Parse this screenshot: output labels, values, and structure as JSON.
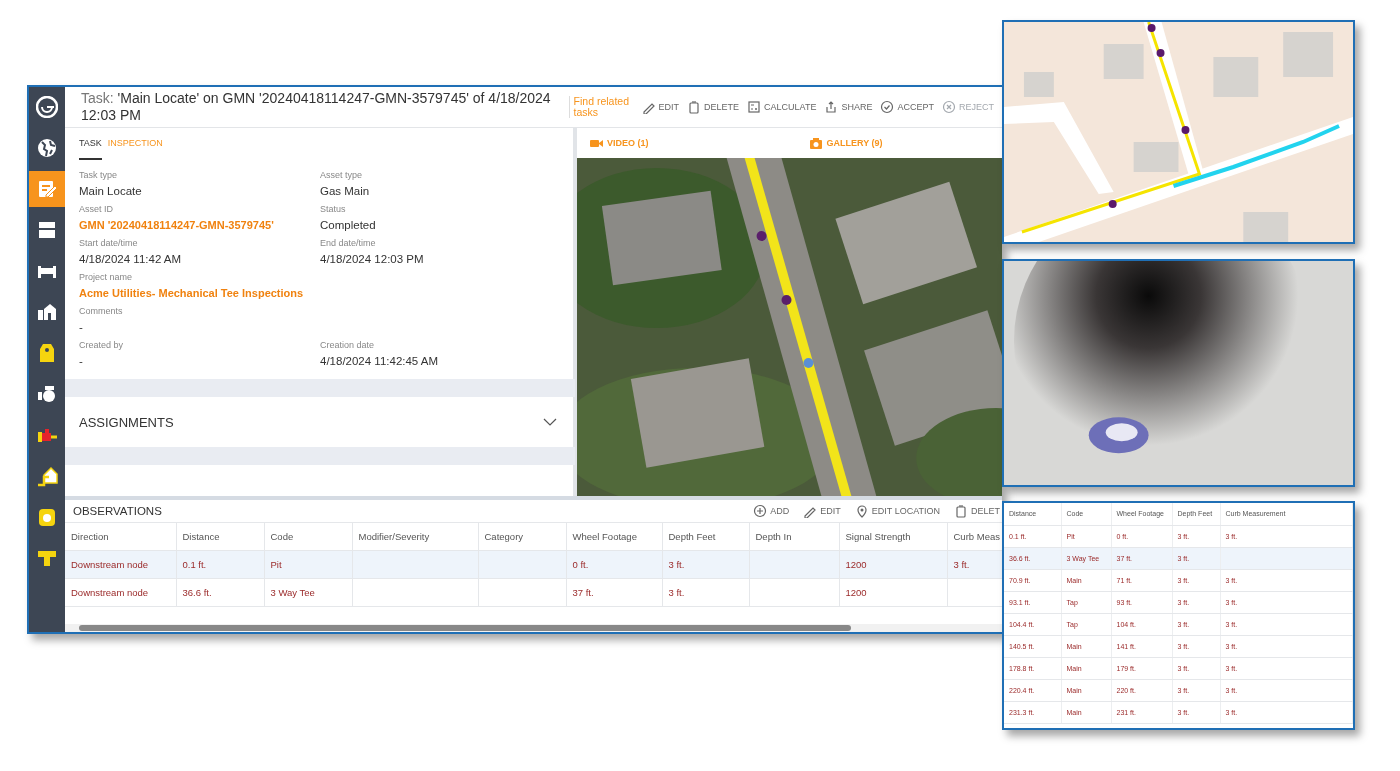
{
  "sidebar": {
    "items": [
      {
        "selected": false
      },
      {
        "selected": false
      },
      {
        "selected": true
      },
      {
        "selected": false
      },
      {
        "selected": false
      },
      {
        "selected": false
      },
      {
        "selected": false
      },
      {
        "selected": false
      },
      {
        "selected": false
      },
      {
        "selected": false
      },
      {
        "selected": false
      },
      {
        "selected": false
      }
    ]
  },
  "header": {
    "title_prefix": "Task:",
    "title": "'Main Locate' on GMN '20240418114247-GMN-3579745' of 4/18/2024 12:03 PM",
    "related_link": "Find related tasks",
    "actions": [
      {
        "label": "EDIT",
        "disabled": false
      },
      {
        "label": "DELETE",
        "disabled": false
      },
      {
        "label": "CALCULATE",
        "disabled": false
      },
      {
        "label": "SHARE",
        "disabled": false
      },
      {
        "label": "ACCEPT",
        "disabled": false
      },
      {
        "label": "REJECT",
        "disabled": true
      }
    ]
  },
  "tabs": [
    {
      "label": "TASK",
      "selected": true
    },
    {
      "label": "INSPECTION",
      "selected": false
    }
  ],
  "field_rows": [
    [
      {
        "label": "Task type",
        "value": "Main Locate",
        "kind": "text"
      },
      {
        "label": "Asset type",
        "value": "Gas Main",
        "kind": "text"
      }
    ],
    [
      {
        "label": "Asset ID",
        "value": "GMN '20240418114247-GMN-3579745'",
        "kind": "link"
      },
      {
        "label": "Status",
        "value": "Completed",
        "kind": "text"
      }
    ],
    [
      {
        "label": "Start date/time",
        "value": "4/18/2024 11:42 AM",
        "kind": "text"
      },
      {
        "label": "End date/time",
        "value": "4/18/2024 12:03 PM",
        "kind": "text"
      }
    ],
    [
      {
        "label": "Project name",
        "value": "Acme Utilities- Mechanical Tee Inspections",
        "kind": "link"
      }
    ],
    [
      {
        "label": "Comments",
        "value": "-",
        "kind": "text"
      }
    ],
    [
      {
        "label": "Created by",
        "value": "-",
        "kind": "text"
      },
      {
        "label": "Creation date",
        "value": "4/18/2024 11:42:45 AM",
        "kind": "text"
      }
    ]
  ],
  "assignments": {
    "title": "ASSIGNMENTS",
    "expanded": false
  },
  "media_tabs": [
    {
      "label": "VIDEO (1)"
    },
    {
      "label": "GALLERY (9)"
    }
  ],
  "observations": {
    "title": "OBSERVATIONS",
    "actions": [
      {
        "label": "ADD"
      },
      {
        "label": "EDIT"
      },
      {
        "label": "EDIT LOCATION"
      },
      {
        "label": "DELET"
      }
    ],
    "columns": [
      "Direction",
      "Distance",
      "Code",
      "Modifier/Severity",
      "Category",
      "Wheel Footage",
      "Depth Feet",
      "Depth In",
      "Signal Strength",
      "Curb Meas"
    ],
    "rows": [
      {
        "selected": true,
        "cells": [
          "Downstream node",
          "0.1 ft.",
          "Pit",
          "",
          "",
          "0 ft.",
          "3 ft.",
          "",
          "1200",
          "3 ft."
        ]
      },
      {
        "selected": false,
        "cells": [
          "Downstream node",
          "36.6 ft.",
          "3 Way Tee",
          "",
          "",
          "37 ft.",
          "3 ft.",
          "",
          "1200",
          ""
        ]
      }
    ]
  },
  "side_table": {
    "columns": [
      "Distance",
      "Code",
      "Wheel Footage",
      "Depth Feet",
      "Curb Measurement"
    ],
    "rows": [
      {
        "selected": false,
        "cells": [
          "0.1 ft.",
          "Pit",
          "0 ft.",
          "3 ft.",
          "3 ft."
        ]
      },
      {
        "selected": true,
        "cells": [
          "36.6 ft.",
          "3 Way Tee",
          "37 ft.",
          "3 ft.",
          ""
        ]
      },
      {
        "selected": false,
        "cells": [
          "70.9 ft.",
          "Main",
          "71 ft.",
          "3 ft.",
          "3 ft."
        ]
      },
      {
        "selected": false,
        "cells": [
          "93.1 ft.",
          "Tap",
          "93 ft.",
          "3 ft.",
          "3 ft."
        ]
      },
      {
        "selected": false,
        "cells": [
          "104.4 ft.",
          "Tap",
          "104 ft.",
          "3 ft.",
          "3 ft."
        ]
      },
      {
        "selected": false,
        "cells": [
          "140.5 ft.",
          "Main",
          "141 ft.",
          "3 ft.",
          "3 ft."
        ]
      },
      {
        "selected": false,
        "cells": [
          "178.8 ft.",
          "Main",
          "179 ft.",
          "3 ft.",
          "3 ft."
        ]
      },
      {
        "selected": false,
        "cells": [
          "220.4 ft.",
          "Main",
          "220 ft.",
          "3 ft.",
          "3 ft."
        ]
      },
      {
        "selected": false,
        "cells": [
          "231.3 ft.",
          "Main",
          "231 ft.",
          "3 ft.",
          "3 ft."
        ]
      }
    ]
  }
}
